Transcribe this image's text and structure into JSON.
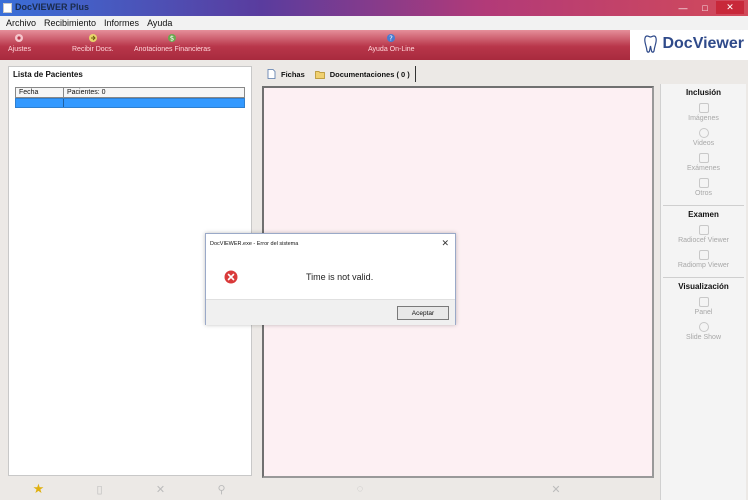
{
  "window": {
    "title": "DocVIEWER Plus",
    "controls": {
      "minimize": "—",
      "maximize": "□",
      "close": "✕"
    }
  },
  "menu": [
    "Archivo",
    "Recibimiento",
    "Informes",
    "Ayuda"
  ],
  "toolbar": {
    "items": [
      {
        "label": "Ajustes",
        "icon": "settings-icon"
      },
      {
        "label": "Recibir Docs.",
        "icon": "receive-docs-icon"
      },
      {
        "label": "Anotaciones Financieras",
        "icon": "finance-icon"
      },
      {
        "label": "Ayuda On-Line",
        "icon": "help-icon"
      }
    ],
    "logo_text": "DocViewer"
  },
  "patients": {
    "title": "Lista de Pacientes",
    "columns": [
      "Fecha",
      "Pacientes: 0"
    ]
  },
  "tabs": [
    {
      "label": "Fichas",
      "icon": "document-icon"
    },
    {
      "label": "Documentaciones ( 0 )",
      "icon": "folder-icon"
    }
  ],
  "sidebar": {
    "inclusion": {
      "title": "Inclusión",
      "items": [
        "Imágenes",
        "Videos",
        "Exámenes",
        "Otros"
      ]
    },
    "examen": {
      "title": "Examen",
      "items": [
        "Radiocef Viewer",
        "Radiomp Viewer"
      ]
    },
    "visualizacion": {
      "title": "Visualización",
      "items": [
        "Panel",
        "Slide Show"
      ]
    }
  },
  "dialog": {
    "title": "DocVIEWER.exe - Error del sistema",
    "message": "Time is not valid.",
    "ok_label": "Aceptar"
  },
  "footer_icons": {
    "left": [
      "star-icon",
      "document-icon",
      "close-icon",
      "search-icon"
    ],
    "center": [
      "refresh-icon",
      "close-icon"
    ]
  },
  "colors": {
    "toolbar": "#b8364a",
    "selection": "#3399ff",
    "doc_area": "#fdf0f3",
    "logo": "#2f4a8a",
    "error": "#d93a3a"
  }
}
